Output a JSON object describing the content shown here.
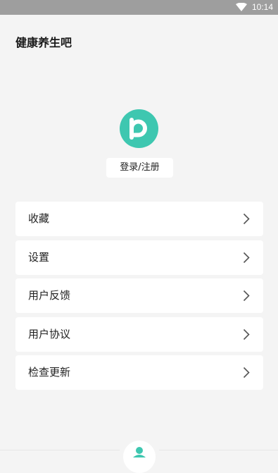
{
  "status_bar": {
    "time": "10:14",
    "icons": [
      "wifi-icon"
    ],
    "background": "#9e9e9e"
  },
  "app": {
    "title": "健康养生吧"
  },
  "profile": {
    "avatar_icon": "app-logo-icon",
    "avatar_color": "#3ec7b0",
    "login_label": "登录/注册"
  },
  "menu": {
    "items": [
      {
        "label": "收藏",
        "icon": "chevron-right-icon"
      },
      {
        "label": "设置",
        "icon": "chevron-right-icon"
      },
      {
        "label": "用户反馈",
        "icon": "chevron-right-icon"
      },
      {
        "label": "用户协议",
        "icon": "chevron-right-icon"
      },
      {
        "label": "检查更新",
        "icon": "chevron-right-icon"
      }
    ]
  },
  "bottom_nav": {
    "active_icon": "person-icon",
    "accent": "#3ec7b0"
  }
}
